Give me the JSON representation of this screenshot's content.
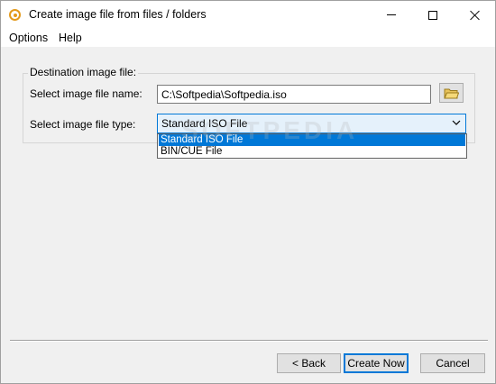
{
  "window": {
    "title": "Create image file from files / folders",
    "icon": "disc-icon"
  },
  "menu": {
    "items": [
      {
        "label": "Options"
      },
      {
        "label": "Help"
      }
    ]
  },
  "destination": {
    "group_label": "Destination image file:",
    "name_label": "Select image file name:",
    "name_value": "C:\\Softpedia\\Softpedia.iso",
    "type_label": "Select image file type:",
    "type_selected": "Standard ISO File",
    "type_options": [
      "Standard ISO File",
      "BIN/CUE File"
    ]
  },
  "watermark": "SOFTPEDIA",
  "buttons": {
    "back": "< Back",
    "create": "Create Now",
    "cancel": "Cancel"
  },
  "colors": {
    "accent": "#0078d7",
    "icon_orange": "#e39a1b"
  }
}
